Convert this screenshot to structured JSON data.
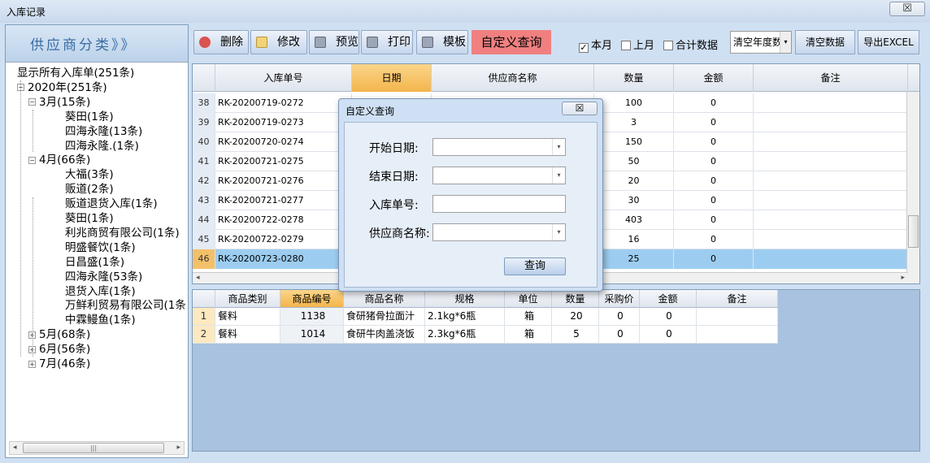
{
  "window": {
    "title": "入库记录",
    "close_glyph": "☒"
  },
  "left": {
    "header": "供应商分类》》",
    "tree": [
      {
        "label": "显示所有入库单(251条)",
        "level": 0,
        "exp": ""
      },
      {
        "label": "2020年(251条)",
        "level": 0,
        "exp": "−"
      },
      {
        "label": "3月(15条)",
        "level": 1,
        "exp": "−"
      },
      {
        "label": "葵田(1条)",
        "level": 2,
        "exp": ""
      },
      {
        "label": "四海永隆(13条)",
        "level": 2,
        "exp": ""
      },
      {
        "label": "四海永隆.(1条)",
        "level": 2,
        "exp": ""
      },
      {
        "label": "4月(66条)",
        "level": 1,
        "exp": "−"
      },
      {
        "label": "大福(3条)",
        "level": 2,
        "exp": ""
      },
      {
        "label": "贩道(2条)",
        "level": 2,
        "exp": ""
      },
      {
        "label": "贩道退货入库(1条)",
        "level": 2,
        "exp": ""
      },
      {
        "label": "葵田(1条)",
        "level": 2,
        "exp": ""
      },
      {
        "label": "利兆商贸有限公司(1条)",
        "level": 2,
        "exp": ""
      },
      {
        "label": "明盛餐饮(1条)",
        "level": 2,
        "exp": ""
      },
      {
        "label": "日昌盛(1条)",
        "level": 2,
        "exp": ""
      },
      {
        "label": "四海永隆(53条)",
        "level": 2,
        "exp": ""
      },
      {
        "label": "退货入库(1条)",
        "level": 2,
        "exp": ""
      },
      {
        "label": "万鲜利贸易有限公司(1条",
        "level": 2,
        "exp": ""
      },
      {
        "label": "中霖鳗鱼(1条)",
        "level": 2,
        "exp": ""
      },
      {
        "label": "5月(68条)",
        "level": 1,
        "exp": "+"
      },
      {
        "label": "6月(56条)",
        "level": 1,
        "exp": "+"
      },
      {
        "label": "7月(46条)",
        "level": 1,
        "exp": "+"
      }
    ]
  },
  "toolbar": {
    "delete": "删除",
    "edit": "修改",
    "preview": "预览",
    "print": "打印",
    "template": "模板",
    "custom_query": "自定义查询",
    "this_month": "本月",
    "last_month": "上月",
    "total_data": "合计数据",
    "year_combo": "清空年度数",
    "clear_data": "清空数据",
    "export": "导出EXCEL",
    "check_mark": "✓",
    "combo_arrow": "▾"
  },
  "grid": {
    "columns": [
      "入库单号",
      "日期",
      "供应商名称",
      "数量",
      "金额",
      "备注"
    ],
    "rows": [
      {
        "idx": "38",
        "no": "RK-20200719-0272",
        "qty": "100",
        "amt": "0"
      },
      {
        "idx": "39",
        "no": "RK-20200719-0273",
        "qty": "3",
        "amt": "0"
      },
      {
        "idx": "40",
        "no": "RK-20200720-0274",
        "qty": "150",
        "amt": "0"
      },
      {
        "idx": "41",
        "no": "RK-20200721-0275",
        "qty": "50",
        "amt": "0"
      },
      {
        "idx": "42",
        "no": "RK-20200721-0276",
        "qty": "20",
        "amt": "0"
      },
      {
        "idx": "43",
        "no": "RK-20200721-0277",
        "qty": "30",
        "amt": "0"
      },
      {
        "idx": "44",
        "no": "RK-20200722-0278",
        "qty": "403",
        "amt": "0"
      },
      {
        "idx": "45",
        "no": "RK-20200722-0279",
        "qty": "16",
        "amt": "0"
      },
      {
        "idx": "46",
        "no": "RK-20200723-0280",
        "qty": "25",
        "amt": "0"
      }
    ],
    "scroll_left": "◂",
    "scroll_right": "▸",
    "scroll_up": "▴",
    "scroll_down": "▾"
  },
  "dialog": {
    "title": "自定义查询",
    "start_date": "开始日期:",
    "end_date": "结束日期:",
    "order_no": "入库单号:",
    "supplier": "供应商名称:",
    "query": "查询",
    "close_glyph": "☒",
    "dropdown_arrow": "▾"
  },
  "detail": {
    "columns": [
      "商品类别",
      "商品编号",
      "商品名称",
      "规格",
      "单位",
      "数量",
      "采购价",
      "金额",
      "备注"
    ],
    "rows": [
      {
        "idx": "1",
        "cat": "餐料",
        "code": "1138",
        "name": "食研猪骨拉面汁",
        "spec": "2.1kg*6瓶",
        "unit": "箱",
        "qty": "20",
        "price": "0",
        "amt": "0"
      },
      {
        "idx": "2",
        "cat": "餐料",
        "code": "1014",
        "name": "食研牛肉盖浇饭",
        "spec": "2.3kg*6瓶",
        "unit": "箱",
        "qty": "5",
        "price": "0",
        "amt": "0"
      }
    ]
  },
  "left_scroll": {
    "left": "◂",
    "right": "▸",
    "grip": "|||"
  }
}
